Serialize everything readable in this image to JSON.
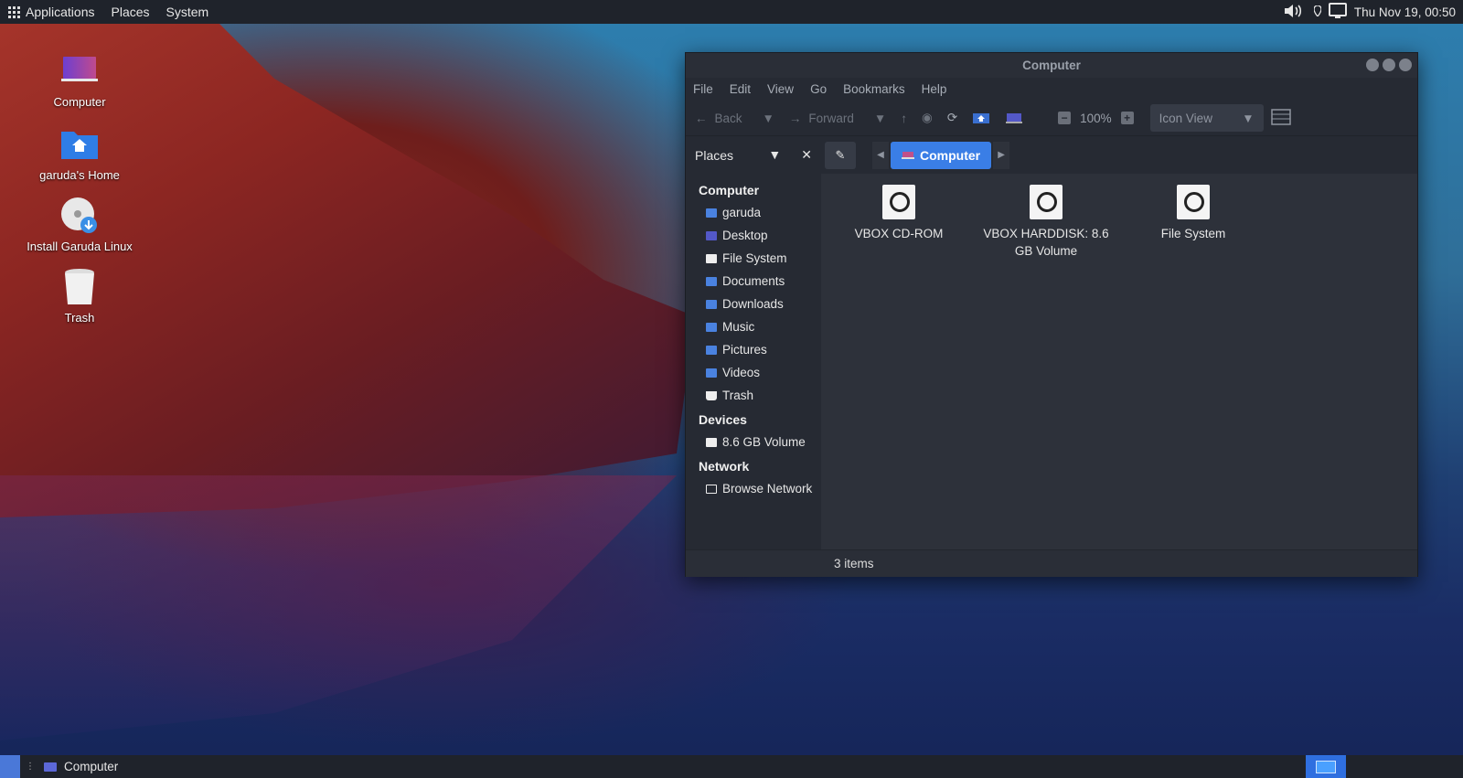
{
  "top_panel": {
    "menus": [
      "Applications",
      "Places",
      "System"
    ],
    "clock": "Thu Nov 19, 00:50",
    "tray_icons": [
      "volume-icon",
      "location-icon",
      "network-icon"
    ]
  },
  "desktop_icons": [
    {
      "label": "Computer",
      "icon": "computer-icon"
    },
    {
      "label": "garuda's Home",
      "icon": "home-folder-icon"
    },
    {
      "label": "Install Garuda Linux",
      "icon": "install-disc-icon"
    },
    {
      "label": "Trash",
      "icon": "trash-icon"
    }
  ],
  "window": {
    "title": "Computer",
    "menubar": [
      "File",
      "Edit",
      "View",
      "Go",
      "Bookmarks",
      "Help"
    ],
    "toolbar": {
      "back_label": "Back",
      "forward_label": "Forward",
      "zoom": "100%",
      "view_mode": "Icon View"
    },
    "places_label": "Places",
    "breadcrumb": "Computer",
    "sidebar": {
      "sections": [
        {
          "title": "Computer",
          "items": [
            "garuda",
            "Desktop",
            "File System",
            "Documents",
            "Downloads",
            "Music",
            "Pictures",
            "Videos",
            "Trash"
          ]
        },
        {
          "title": "Devices",
          "items": [
            "8.6 GB Volume"
          ]
        },
        {
          "title": "Network",
          "items": [
            "Browse Network"
          ]
        }
      ]
    },
    "files": [
      {
        "line1": "VBOX CD-ROM",
        "line2": ""
      },
      {
        "line1": "VBOX HARDDISK: 8.6",
        "line2": "GB Volume"
      },
      {
        "line1": "File System",
        "line2": ""
      }
    ],
    "status": "3 items"
  },
  "bottom_panel": {
    "task_label": "Computer"
  },
  "colors": {
    "accent": "#3a7ee6",
    "panel": "#1f232b",
    "window_bg": "#262a33"
  }
}
